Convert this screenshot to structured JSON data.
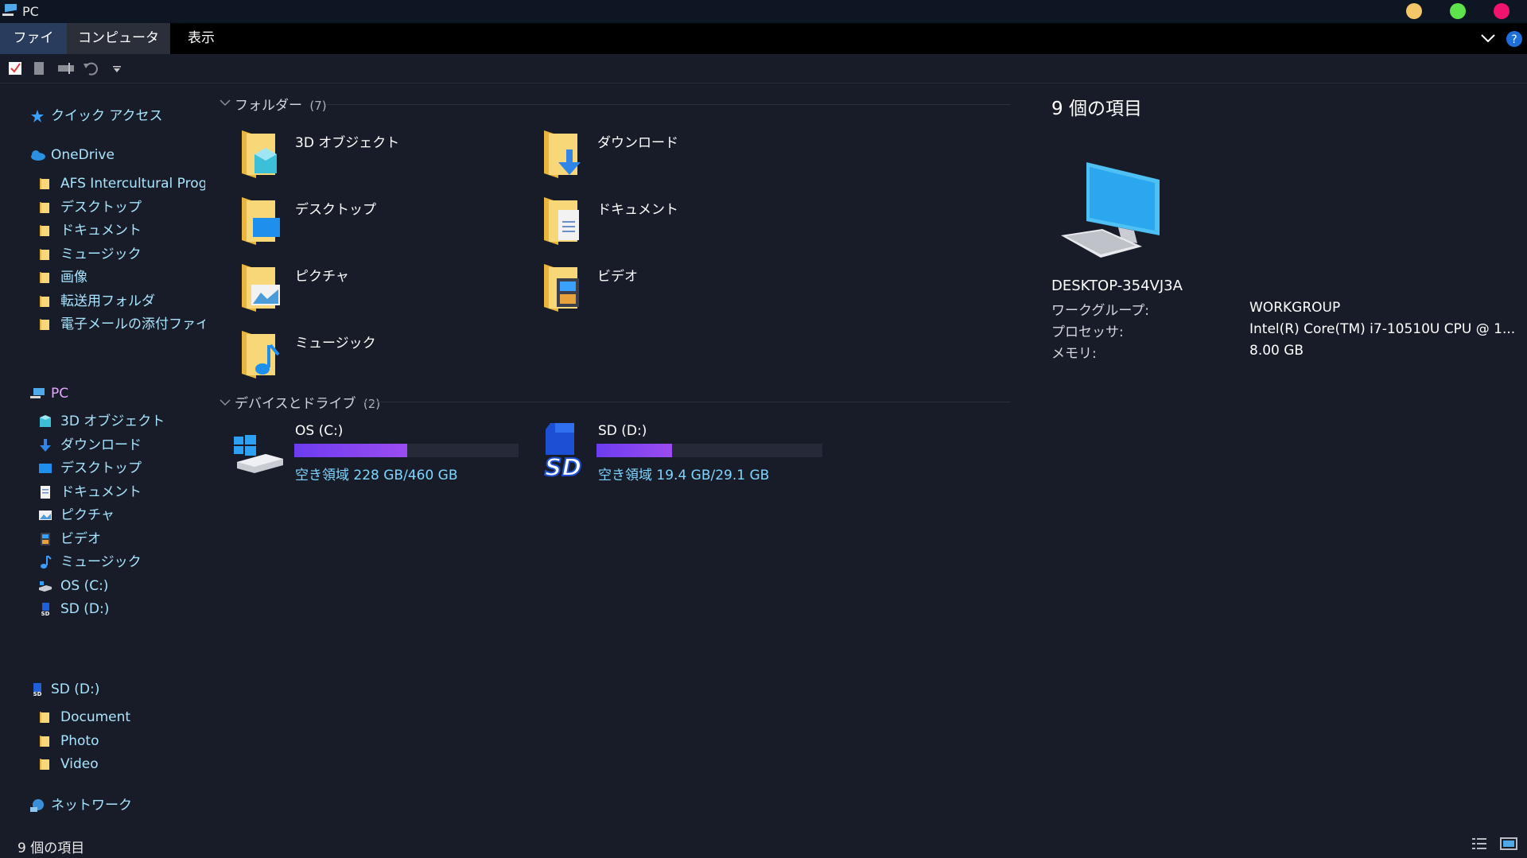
{
  "window": {
    "title": "PC"
  },
  "ribbon": {
    "tabs": [
      "ファイル",
      "コンピューター",
      "表示"
    ]
  },
  "sidebar": {
    "quick_access": "クイック アクセス",
    "onedrive": "OneDrive",
    "onedrive_items": [
      "AFS Intercultural Progra",
      "デスクトップ",
      "ドキュメント",
      "ミュージック",
      "画像",
      "転送用フォルダ",
      "電子メールの添付ファイ"
    ],
    "pc": "PC",
    "pc_items": [
      "3D オブジェクト",
      "ダウンロード",
      "デスクトップ",
      "ドキュメント",
      "ピクチャ",
      "ビデオ",
      "ミュージック",
      "OS (C:)",
      "SD (D:)"
    ],
    "sd": "SD (D:)",
    "sd_items": [
      "Document",
      "Photo",
      "Video"
    ],
    "network": "ネットワーク"
  },
  "main": {
    "folders_header": "フォルダー",
    "folders_count": "(7)",
    "folders": [
      "3D オブジェクト",
      "ダウンロード",
      "デスクトップ",
      "ドキュメント",
      "ピクチャ",
      "ビデオ",
      "ミュージック"
    ],
    "drives_header": "デバイスとドライブ",
    "drives_count": "(2)",
    "drives": [
      {
        "name": "OS (C:)",
        "free_text": "空き領域 228 GB/460 GB",
        "used_fraction": 0.504
      },
      {
        "name": "SD (D:)",
        "free_text": "空き領域 19.4 GB/29.1 GB",
        "used_fraction": 0.333
      }
    ]
  },
  "details": {
    "count": "9 個の項目",
    "computer_name": "DESKTOP-354VJ3A",
    "workgroup_label": "ワークグループ:",
    "workgroup_value": "WORKGROUP",
    "processor_label": "プロセッサ:",
    "processor_value": "Intel(R) Core(TM) i7-10510U CPU @ 1...",
    "memory_label": "メモリ:",
    "memory_value": "8.00 GB"
  },
  "status": {
    "count": "9 個の項目"
  },
  "colors": {
    "accent_link": "#7fd5ff",
    "nav_text": "#a9e4ff",
    "folder": "#f5c34a",
    "bar": "#7b3ff0",
    "background": "#181c28"
  }
}
